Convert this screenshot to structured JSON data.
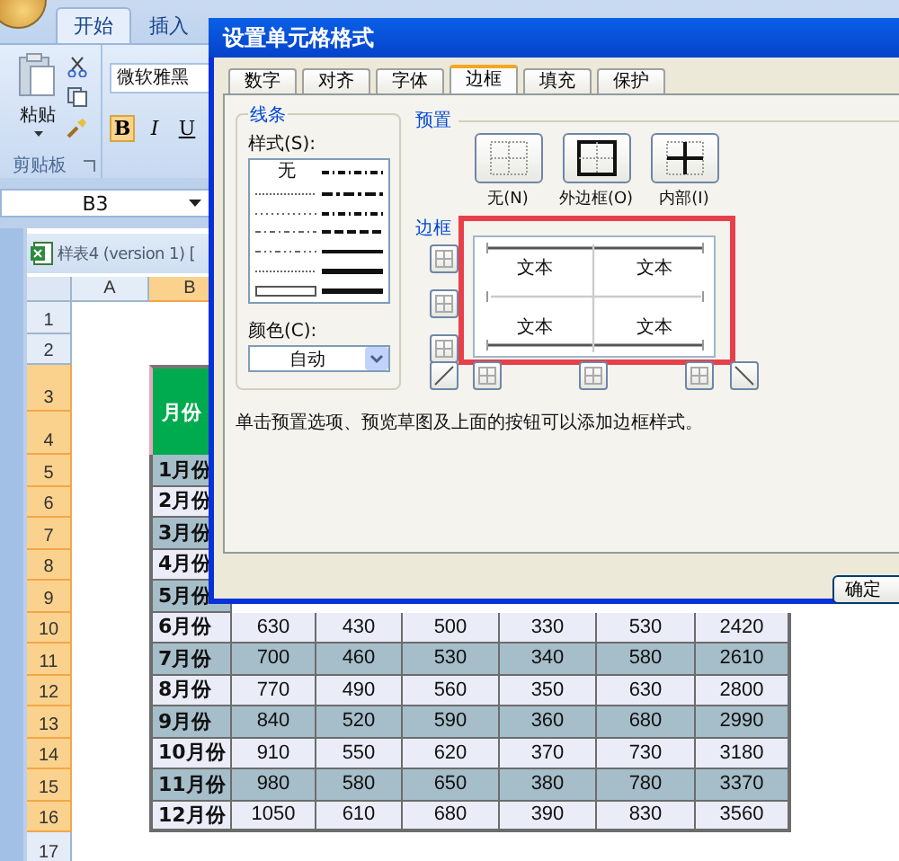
{
  "ribbon": {
    "tabs": [
      {
        "label": "开始",
        "selected": true
      },
      {
        "label": "插入",
        "selected": false
      }
    ],
    "clipboard": {
      "paste_label": "粘贴",
      "group_label": "剪贴板"
    },
    "font": {
      "font_name": "微软雅黑",
      "buttons": [
        {
          "label": "B",
          "selected": true
        },
        {
          "label": "I",
          "selected": false
        },
        {
          "label": "U",
          "selected": false
        }
      ]
    }
  },
  "name_box": "B3",
  "workbook": {
    "title": "样表4 (version 1) [",
    "columns": [
      {
        "label": "A",
        "selected": false
      },
      {
        "label": "B",
        "selected": true
      }
    ],
    "rows": [
      {
        "label": "1",
        "selected": false
      },
      {
        "label": "2",
        "selected": false
      },
      {
        "label": "3",
        "selected": true
      },
      {
        "label": "4",
        "selected": true
      },
      {
        "label": "5",
        "selected": true
      },
      {
        "label": "6",
        "selected": true
      },
      {
        "label": "7",
        "selected": true
      },
      {
        "label": "8",
        "selected": true
      },
      {
        "label": "9",
        "selected": true
      },
      {
        "label": "10",
        "selected": true
      },
      {
        "label": "11",
        "selected": true
      },
      {
        "label": "12",
        "selected": true
      },
      {
        "label": "13",
        "selected": true
      },
      {
        "label": "14",
        "selected": true
      },
      {
        "label": "15",
        "selected": true
      },
      {
        "label": "16",
        "selected": true
      },
      {
        "label": "17",
        "selected": false
      }
    ]
  },
  "table": {
    "header": "月份",
    "rows": [
      {
        "month": "1月份"
      },
      {
        "month": "2月份"
      },
      {
        "month": "3月份"
      },
      {
        "month": "4月份"
      },
      {
        "month": "5月份"
      },
      {
        "month": "6月份",
        "values": [
          "630",
          "430",
          "500",
          "330",
          "530",
          "2420"
        ]
      },
      {
        "month": "7月份",
        "values": [
          "700",
          "460",
          "530",
          "340",
          "580",
          "2610"
        ]
      },
      {
        "month": "8月份",
        "values": [
          "770",
          "490",
          "560",
          "350",
          "630",
          "2800"
        ]
      },
      {
        "month": "9月份",
        "values": [
          "840",
          "520",
          "590",
          "360",
          "680",
          "2990"
        ]
      },
      {
        "month": "10月份",
        "values": [
          "910",
          "550",
          "620",
          "370",
          "730",
          "3180"
        ]
      },
      {
        "month": "11月份",
        "values": [
          "980",
          "580",
          "650",
          "380",
          "780",
          "3370"
        ]
      },
      {
        "month": "12月份",
        "values": [
          "1050",
          "610",
          "680",
          "390",
          "830",
          "3560"
        ]
      }
    ]
  },
  "dialog": {
    "title": "设置单元格格式",
    "tabs": [
      {
        "label": "数字",
        "selected": false
      },
      {
        "label": "对齐",
        "selected": false
      },
      {
        "label": "字体",
        "selected": false
      },
      {
        "label": "边框",
        "selected": true
      },
      {
        "label": "填充",
        "selected": false
      },
      {
        "label": "保护",
        "selected": false
      }
    ],
    "line": {
      "group_label": "线条",
      "style_label": "样式(S):",
      "none_label": "无",
      "color_label": "颜色(C):",
      "color_value": "自动"
    },
    "presets": {
      "label": "预置",
      "items": [
        {
          "label": "无(N)",
          "kind": "none"
        },
        {
          "label": "外边框(O)",
          "kind": "outline"
        },
        {
          "label": "内部(I)",
          "kind": "inside"
        }
      ]
    },
    "border": {
      "label": "边框",
      "preview_texts": [
        "文本",
        "文本",
        "文本",
        "文本"
      ]
    },
    "hint": "单击预置选项、预览草图及上面的按钮可以添加边框样式。",
    "ok_button": "确定"
  }
}
